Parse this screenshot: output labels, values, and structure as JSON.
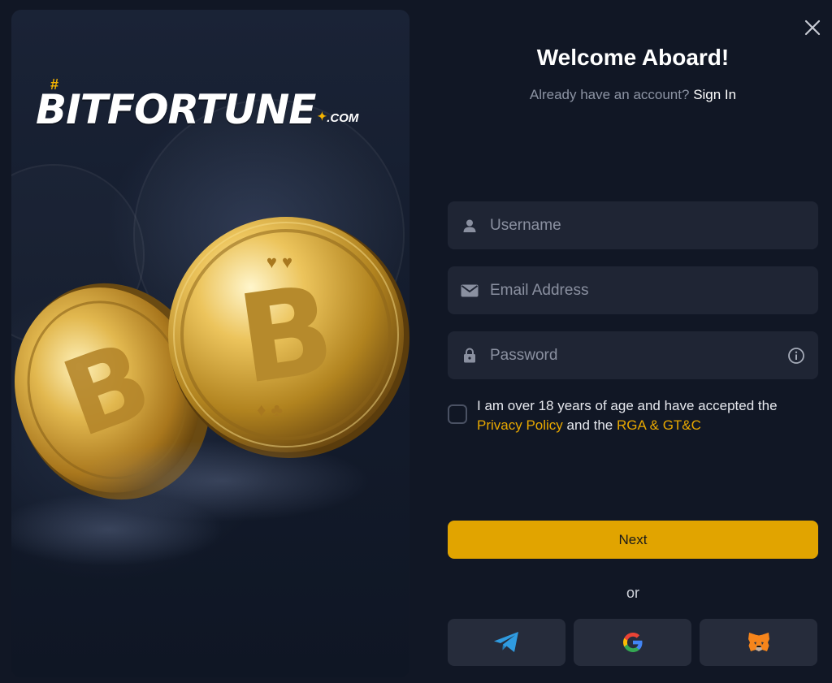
{
  "brand": {
    "logo_text": "BITFORTUNE",
    "logo_suffix": ".COM",
    "accent_color": "#e1a400"
  },
  "header": {
    "title": "Welcome Aboard!",
    "subtitle_text": "Already have an account?",
    "signin_link": "Sign In"
  },
  "form": {
    "username_placeholder": "Username",
    "email_placeholder": "Email Address",
    "password_placeholder": "Password",
    "terms_prefix": "I am over 18 years of age and have accepted the",
    "privacy_link": "Privacy Policy",
    "terms_middle": "and the",
    "rga_link": "RGA & GT&C",
    "next_label": "Next",
    "or_label": "or"
  },
  "social": [
    {
      "name": "telegram",
      "icon": "telegram-icon"
    },
    {
      "name": "google",
      "icon": "google-icon"
    },
    {
      "name": "metamask",
      "icon": "metamask-icon"
    }
  ],
  "icons": {
    "close": "close-icon",
    "user": "user-icon",
    "email": "envelope-icon",
    "lock": "lock-icon",
    "info": "info-icon"
  }
}
